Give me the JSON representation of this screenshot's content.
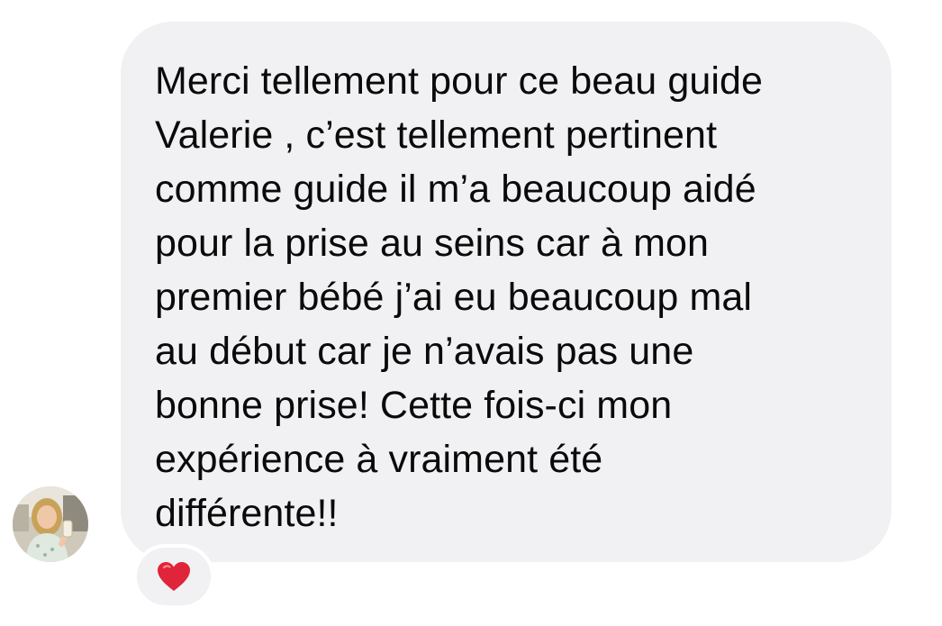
{
  "message": {
    "lines": [
      "Merci tellement pour ce beau guide",
      "Valerie , c’est tellement pertinent",
      "comme guide il m’a beaucoup aidé",
      "pour la prise au seins car à mon",
      "premier bébé j’ai eu beaucoup mal",
      "au début car je n’avais pas une",
      "bonne prise! Cette fois-ci mon",
      "expérience à vraiment été",
      "différente!!"
    ],
    "bubble_color": "#f1f1f3",
    "text_color": "#0a0a0a"
  },
  "sender": {
    "avatar_icon": "user-avatar-photo"
  },
  "reaction": {
    "icon": "red-heart-icon",
    "color": "#e0243a"
  }
}
